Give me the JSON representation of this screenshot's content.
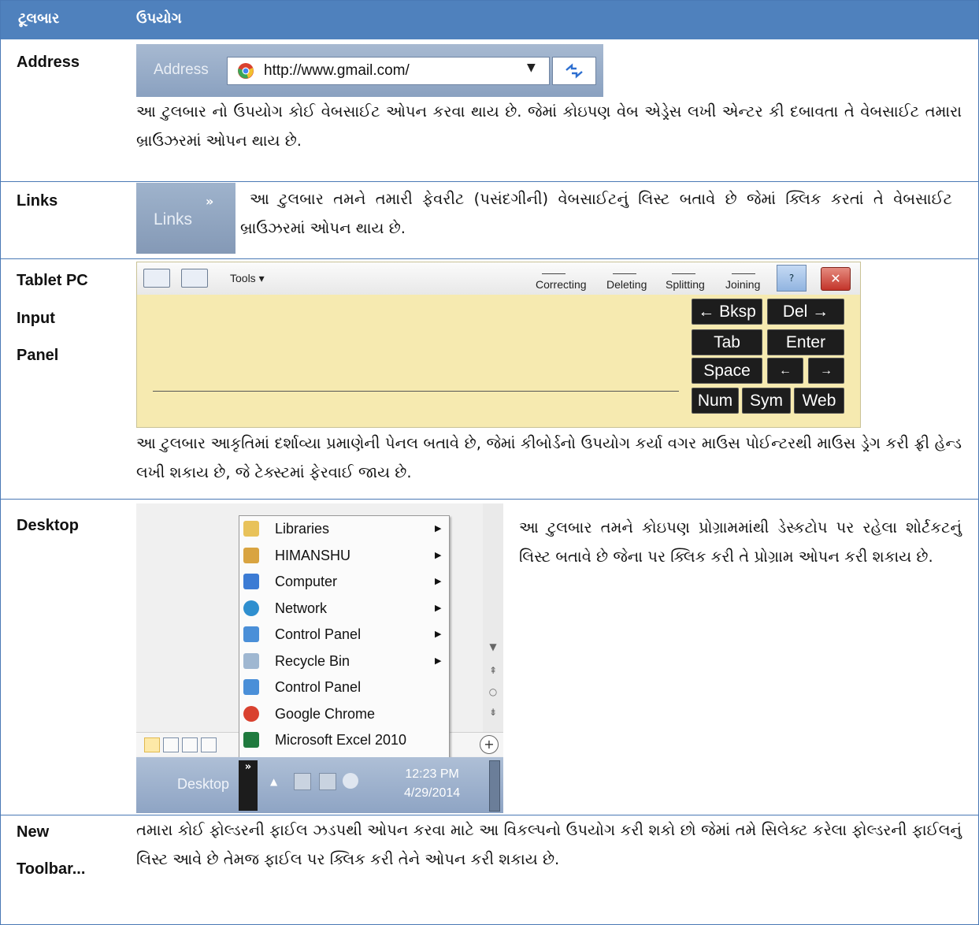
{
  "header": {
    "col1": "ટૂલબાર",
    "col2": "ઉપયોગ"
  },
  "address": {
    "label": "Address",
    "shot_label": "Address",
    "url": "http://www.gmail.com/",
    "description": "આ ટુલબાર નો ઉપયોગ કોઈ વેબસાઈટ ઓપન કરવા થાય છે. જેમાં કોઇપણ વેબ એડ્રેસ લખી એન્ટર કી દબાવતા તે વેબસાઈટ તમારા બ્રાઉઝરમાં ઓપન થાય છે."
  },
  "links": {
    "label": "Links",
    "shot_label": "Links",
    "description": "આ ટુલબાર તમને તમારી ફેવરીટ (પસંદગીની) વેબસાઈટનું લિસ્ટ બતાવે છે જેમાં ક્લિક કરતાં તે વેબસાઈટ બ્રાઉઝરમાં ઓપન થાય છે."
  },
  "tablet": {
    "label_line1": "Tablet  PC",
    "label_line2": "Input",
    "label_line3": "Panel",
    "tools": "Tools ▾",
    "actions": [
      "Correcting",
      "Deleting",
      "Splitting",
      "Joining"
    ],
    "keys": [
      "← Bksp",
      "Del →",
      "Tab",
      "Enter",
      "Space",
      "←",
      "→",
      "Num",
      "Sym",
      "Web"
    ],
    "description": "આ ટુલબાર આકૃતિમાં દર્શાવ્યા પ્રમાણેની પેનલ બતાવે છે, જેમાં કીબોર્ડનો ઉપયોગ કર્યા વગર માઉસ પોઈન્ટરથી માઉસ ડ્રેગ કરી ફ્રી હેન્ડ લખી શકાય છે, જે ટેક્સ્ટમાં ફેરવાઈ જાય છે."
  },
  "desktop": {
    "label": "Desktop",
    "menu_items": [
      {
        "label": "Libraries",
        "icon": "folder-icon",
        "color": "#e8c25a",
        "submenu": true
      },
      {
        "label": "HIMANSHU",
        "icon": "user-folder-icon",
        "color": "#d9a441",
        "submenu": true
      },
      {
        "label": "Computer",
        "icon": "computer-icon",
        "color": "#3b7bd4",
        "submenu": true
      },
      {
        "label": "Network",
        "icon": "network-icon",
        "color": "#2f8fcf",
        "submenu": true
      },
      {
        "label": "Control Panel",
        "icon": "control-panel-icon",
        "color": "#4a8fd8",
        "submenu": true
      },
      {
        "label": "Recycle Bin",
        "icon": "recycle-bin-icon",
        "color": "#9fb7d1",
        "submenu": true
      },
      {
        "label": "Control Panel",
        "icon": "control-panel-icon",
        "color": "#4a8fd8",
        "submenu": false
      },
      {
        "label": "Google Chrome",
        "icon": "chrome-icon",
        "color": "#d9412f",
        "submenu": false
      },
      {
        "label": "Microsoft Excel 2010",
        "icon": "excel-icon",
        "color": "#1f7a3e",
        "submenu": false
      }
    ],
    "taskbar_label": "Desktop",
    "time": "12:23 PM",
    "date": "4/29/2014",
    "description": "આ ટુલબાર તમને કોઇપણ પ્રોગ્રામમાંથી ડેસ્કટોપ પર રહેલા શોર્ટકટનું લિસ્ટ બતાવે છે જેના પર ક્લિક કરી તે પ્રોગ્રામ ઓપન કરી શકાય છે."
  },
  "newtoolbar": {
    "label_line1": "New",
    "label_line2": "Toolbar...",
    "description": "તમારા કોઈ ફોલ્ડરની ફાઈલ ઝડપથી ઓપન કરવા માટે આ વિકલ્પનો ઉપયોગ કરી શકો છો જેમાં તમે સિલેક્ટ કરેલા ફોલ્ડરની ફાઈલનું લિસ્ટ આવે છે તેમજ ફાઈલ પર ક્લિક કરી તેને ઓપન કરી શકાય છે."
  },
  "colors": {
    "header_bg": "#4f81bd",
    "border": "#4a79b5",
    "panel_bg": "#f6eab0"
  }
}
